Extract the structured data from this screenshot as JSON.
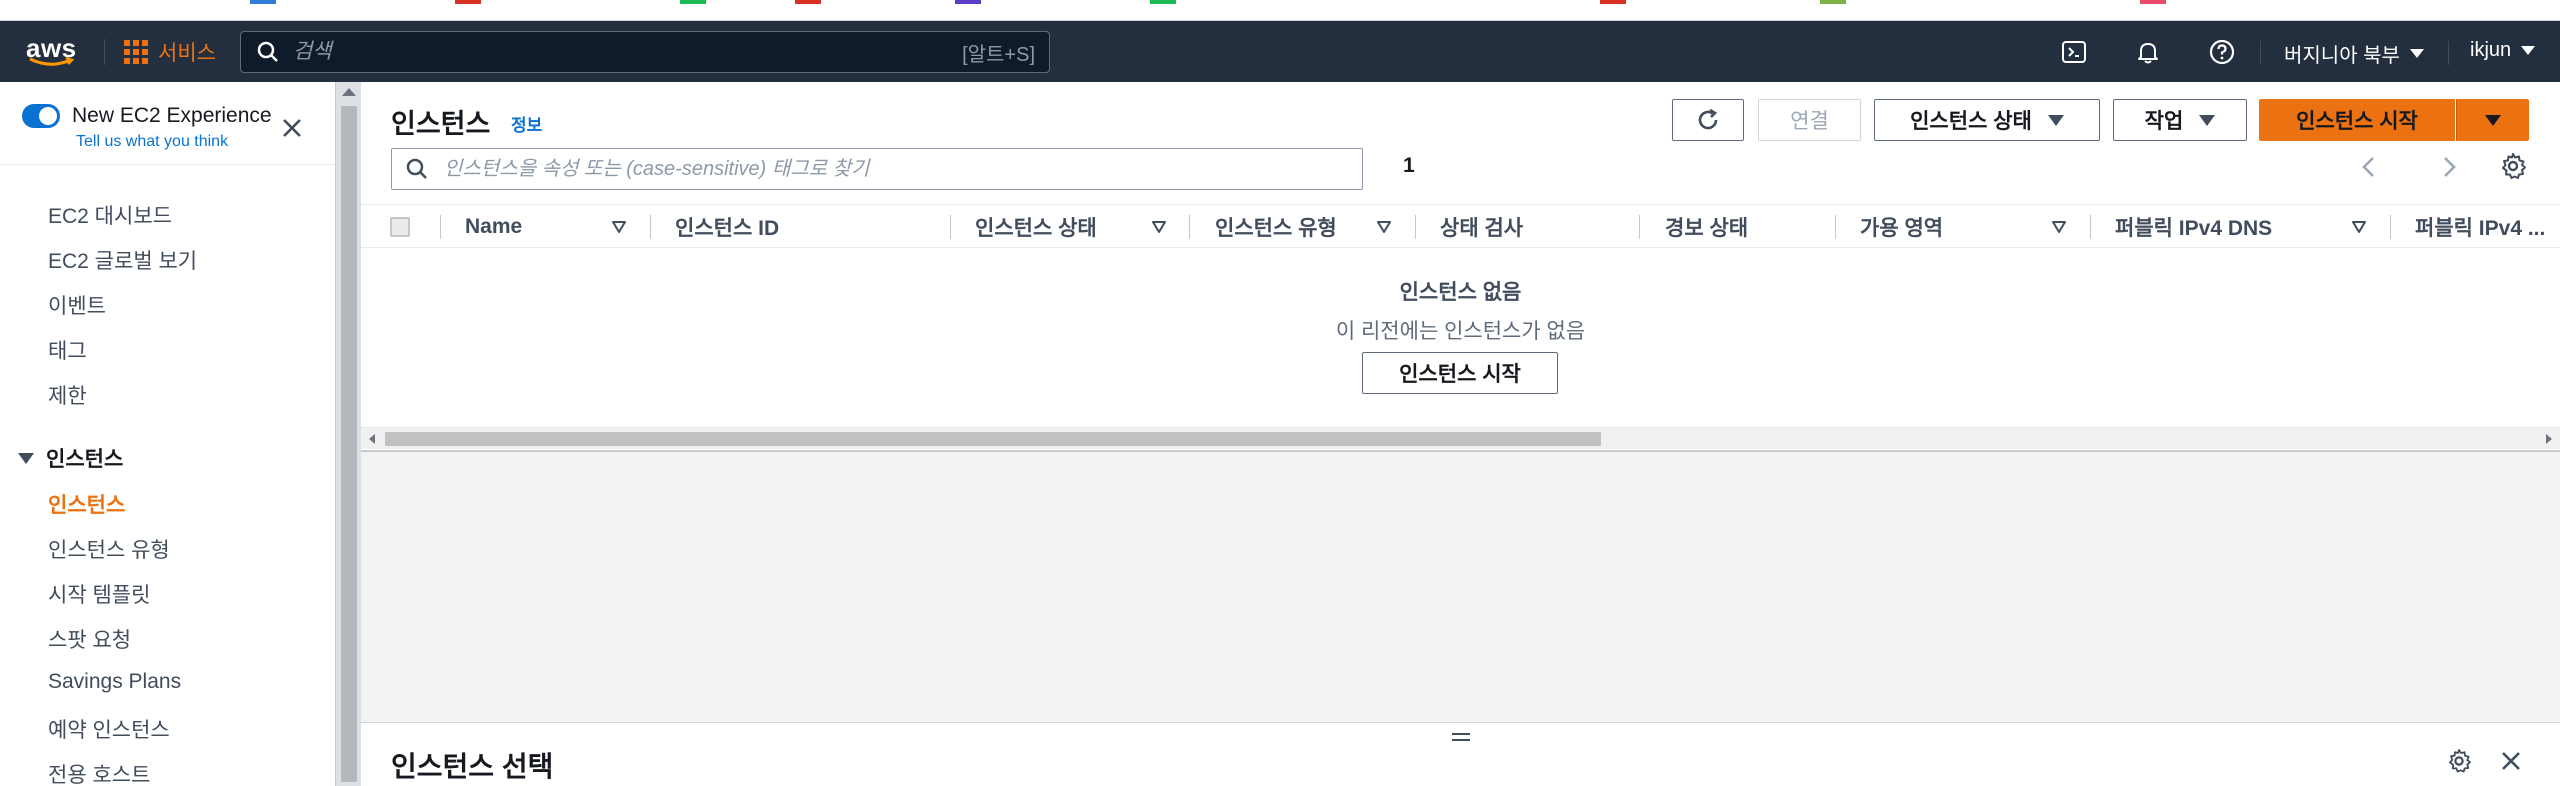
{
  "topnav": {
    "logo": "aws",
    "services_label": "서비스",
    "search_placeholder": "검색",
    "search_shortcut": "[알트+S]",
    "region_label": "버지니아 북부",
    "user_label": "ikjun",
    "icons": [
      "cloudshell-icon",
      "bell-icon",
      "help-icon"
    ]
  },
  "sidebar": {
    "experience_title": "New EC2 Experience",
    "experience_link": "Tell us what you think",
    "toggle_on": true,
    "items_top": [
      "EC2 대시보드",
      "EC2 글로벌 보기",
      "이벤트",
      "태그",
      "제한"
    ],
    "section_instances": "인스턴스",
    "items_instances": [
      "인스턴스",
      "인스턴스 유형",
      "시작 템플릿",
      "스팟 요청",
      "Savings Plans",
      "예약 인스턴스",
      "전용 호스트"
    ],
    "active_item": "인스턴스"
  },
  "main": {
    "title": "인스턴스",
    "info_link": "정보",
    "connect_label": "연결",
    "instance_state_label": "인스턴스 상태",
    "actions_label": "작업",
    "launch_label": "인스턴스 시작",
    "filter_placeholder": "인스턴스을 속성 또는 (case-sensitive) 태그로 찾기",
    "page_number": "1",
    "columns": [
      "Name",
      "인스턴스 ID",
      "인스턴스 상태",
      "인스턴스 유형",
      "상태 검사",
      "경보 상태",
      "가용 영역",
      "퍼블릭 IPv4 DNS",
      "퍼블릭 IPv4 ..."
    ],
    "empty_title": "인스턴스 없음",
    "empty_subtitle": "이 리전에는 인스턴스가 없음",
    "empty_button": "인스턴스 시작"
  },
  "split_panel": {
    "title": "인스턴스 선택"
  },
  "colors": {
    "nav_bg": "#232f3e",
    "accent_orange": "#ec7211",
    "link_blue": "#0972d3"
  }
}
